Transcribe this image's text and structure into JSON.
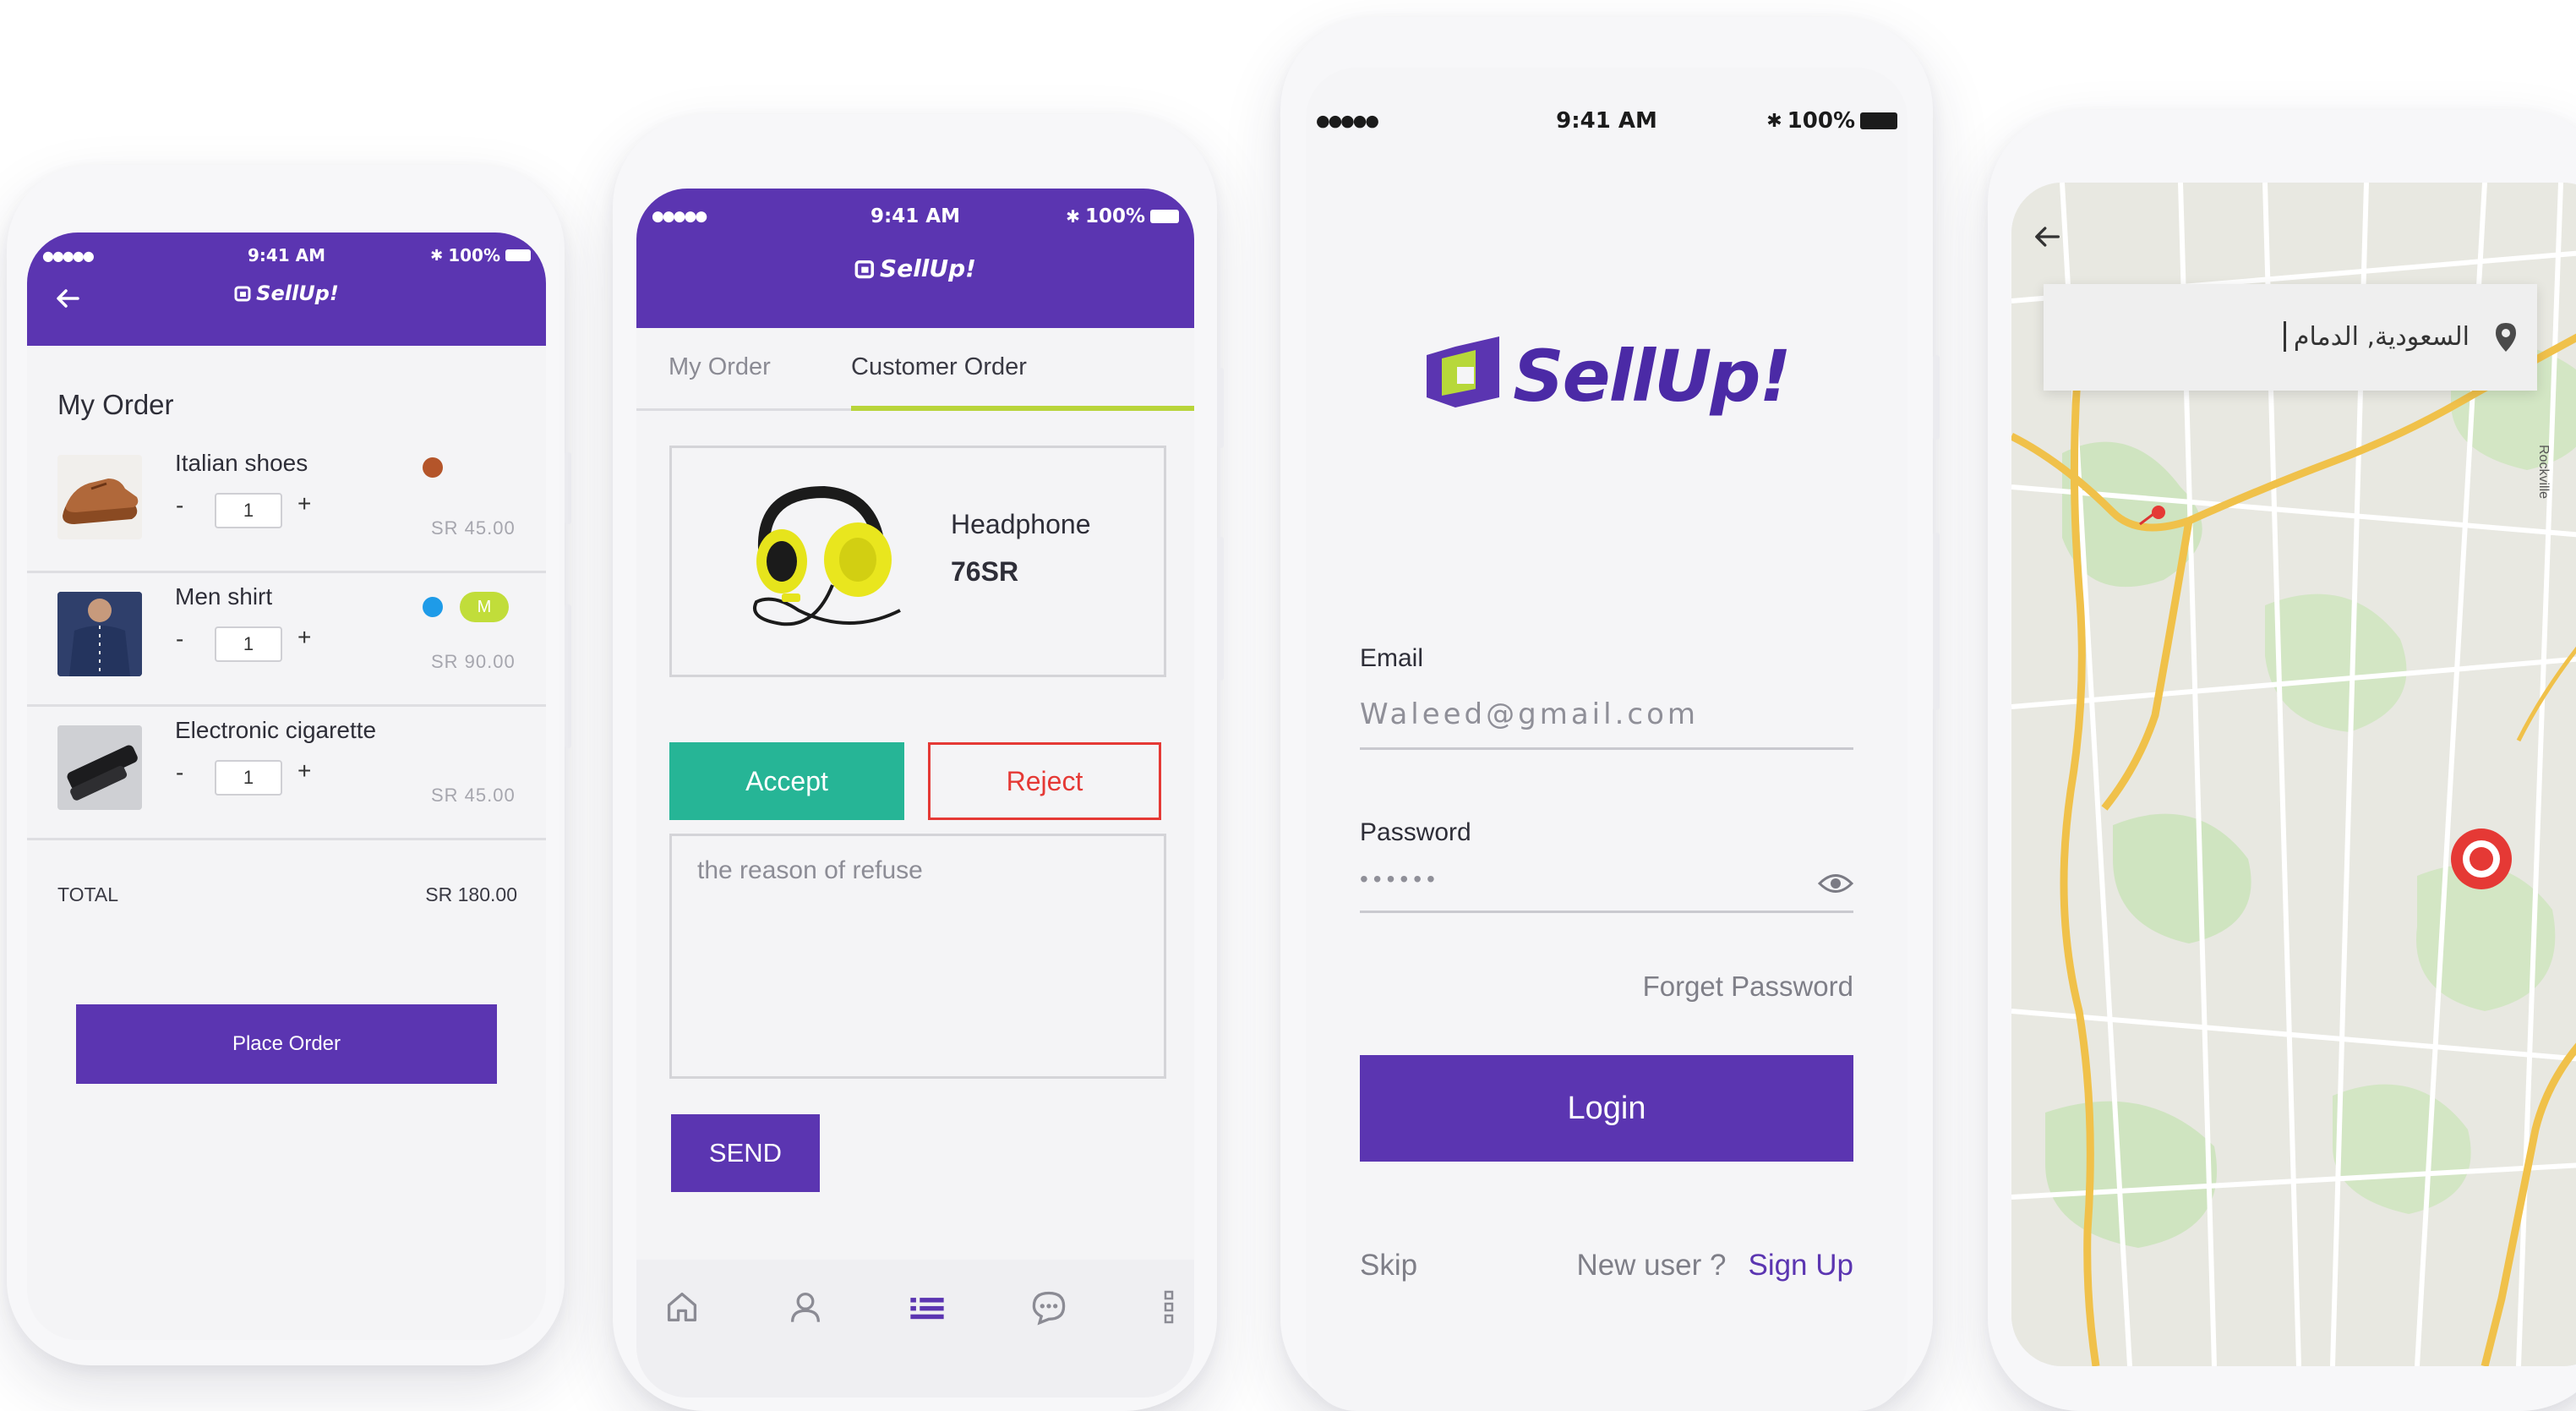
{
  "status_bar": {
    "signal": "●●●●●",
    "time": "9:41 AM",
    "battery": "100%"
  },
  "brand": {
    "name": "SellUp!",
    "primary": "#5b35b1",
    "accent_green": "#26b596",
    "reject_red": "#e53935",
    "tab_underline": "#b8d43a"
  },
  "phone_order": {
    "back_icon": "back-arrow-icon",
    "title": "My Order",
    "items": [
      {
        "name": "Italian shoes",
        "qty": "1",
        "price": "SR 45.00",
        "color": "#b4552a",
        "size": ""
      },
      {
        "name": "Men shirt",
        "qty": "1",
        "price": "SR 90.00",
        "color": "#1e9be8",
        "size": "M"
      },
      {
        "name": "Electronic cigarette",
        "qty": "1",
        "price": "SR 45.00",
        "color": "",
        "size": ""
      }
    ],
    "minus": "-",
    "plus": "+",
    "total_label": "TOTAL",
    "total_value": "SR 180.00",
    "place_order": "Place Order"
  },
  "phone_customer": {
    "tabs": [
      "My Order",
      "Customer Order"
    ],
    "active_tab": 1,
    "product_name": "Headphone",
    "product_price": "76SR",
    "accept": "Accept",
    "reject": "Reject",
    "reason_placeholder": "the reason of refuse",
    "send": "SEND",
    "nav_icons": [
      "home-icon",
      "profile-icon",
      "orders-icon",
      "chat-icon",
      "more-icon"
    ]
  },
  "phone_login": {
    "email_label": "Email",
    "email_value": "Waleed@gmail.com",
    "password_label": "Password",
    "password_value": "••••••",
    "forget": "Forget Password",
    "login": "Login",
    "skip": "Skip",
    "new_user": "New user ?",
    "sign_up": "Sign Up"
  },
  "phone_map": {
    "location": "السعودية, الدمام",
    "road_label": "Rockville"
  }
}
